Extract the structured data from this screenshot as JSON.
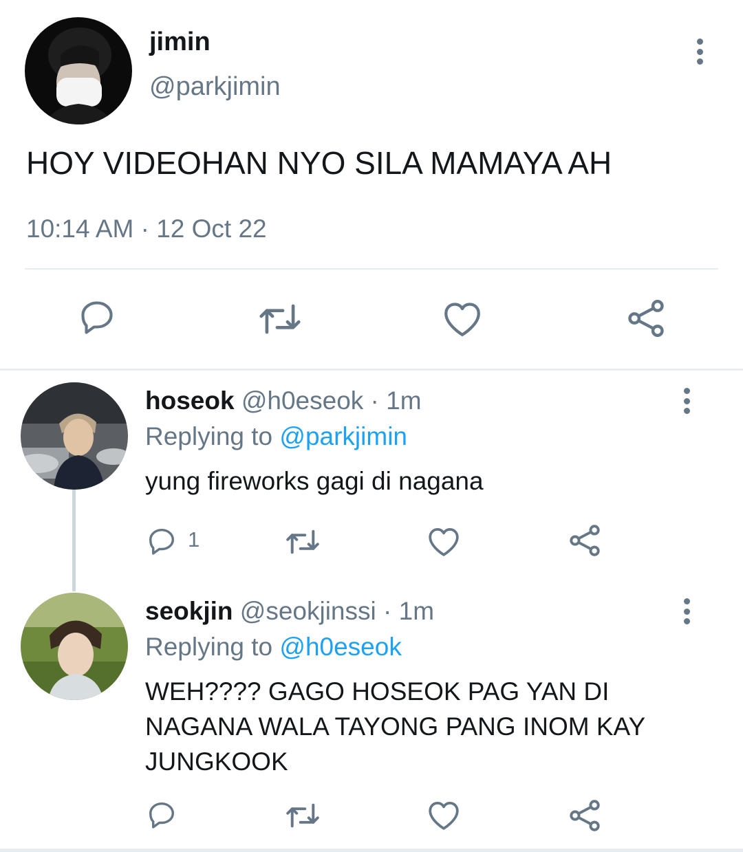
{
  "main_tweet": {
    "name": "jimin",
    "handle": "@parkjimin",
    "text": "HOY VIDEOHAN NYO SILA MAMAYA AH",
    "timestamp": "10:14 AM · 12 Oct 22",
    "actions": [
      "reply-icon",
      "retweet-icon",
      "like-icon",
      "share-icon"
    ]
  },
  "replies": [
    {
      "name": "hoseok",
      "meta": "@h0eseok · 1m",
      "replying_prefix": "Replying to ",
      "replying_to": "@parkjimin",
      "text": "yung fireworks gagi di nagana",
      "reply_count": "1"
    },
    {
      "name": "seokjin",
      "meta": "@seokjinssi · 1m",
      "replying_prefix": "Replying to ",
      "replying_to": "@h0eseok",
      "text": "WEH???? GAGO HOSEOK PAG YAN DI NAGANA WALA TAYONG PANG INOM KAY JUNGKOOK",
      "reply_count": ""
    }
  ],
  "colors": {
    "text_primary": "#14171a",
    "text_secondary": "#657786",
    "mention": "#1da1f2",
    "divider": "#e6ecf0"
  }
}
